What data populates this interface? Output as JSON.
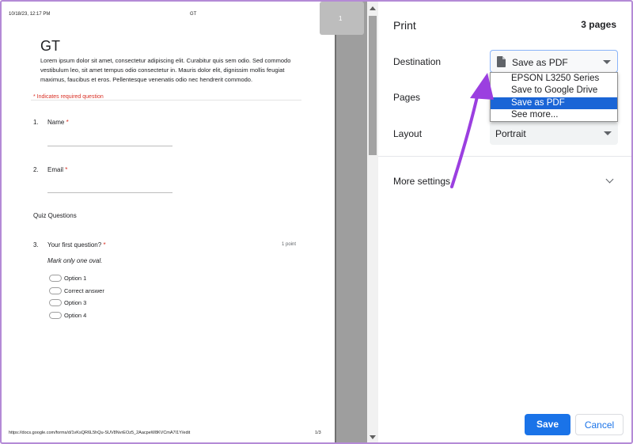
{
  "preview": {
    "header_date": "10/18/23, 12:17 PM",
    "header_title": "GT",
    "form_title": "GT",
    "description": "Lorem ipsum dolor sit amet, consectetur adipiscing elit. Curabitur quis sem odio. Sed commodo vestibulum leo, sit amet tempus odio consectetur in. Mauris dolor elit, dignissim mollis feugiat maximus, faucibus et eros. Pellentesque venenatis odio nec hendrerit commodo.",
    "required_note": "* Indicates required question",
    "questions": [
      {
        "num": "1.",
        "label": "Name",
        "star": "*"
      },
      {
        "num": "2.",
        "label": "Email",
        "star": "*"
      },
      {
        "num": "3.",
        "label": "Your first question?",
        "star": "*"
      }
    ],
    "section_title": "Quiz Questions",
    "points": "1 point",
    "hint": "Mark only one oval.",
    "options": [
      "Option 1",
      "Correct answer",
      "Option 3",
      "Option 4"
    ],
    "footer_url": "https://docs.google.com/forms/d/1vKsQR6L5hQu-SUV8NvrEOz5_2AacpeW8KVCmA7I1Y/edit",
    "footer_page": "1/3",
    "thumbnail_number": "1"
  },
  "panel": {
    "title": "Print",
    "page_count": "3 pages",
    "destination_label": "Destination",
    "destination_value": "Save as PDF",
    "destination_options": [
      "EPSON L3250 Series",
      "Save to Google Drive",
      "Save as PDF",
      "See more..."
    ],
    "destination_selected_index": 2,
    "pages_label": "Pages",
    "layout_label": "Layout",
    "layout_value": "Portrait",
    "more_settings_label": "More settings",
    "save_label": "Save",
    "cancel_label": "Cancel"
  },
  "colors": {
    "accent": "#1a73e8",
    "selected_option": "#1a65d6",
    "required": "#d93025",
    "annotation_arrow": "#9b3fe0",
    "frame": "#b48ad6"
  },
  "icons": {
    "destination": "document-icon",
    "annotation": "purple-arrow"
  }
}
